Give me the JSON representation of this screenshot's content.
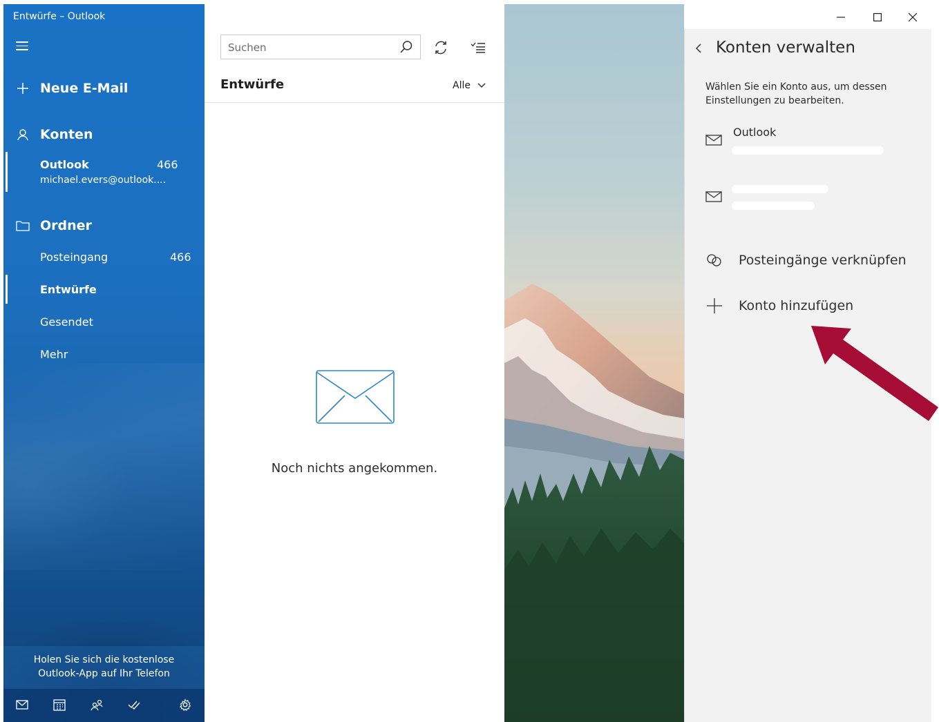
{
  "window": {
    "title": "Entwürfe – Outlook"
  },
  "nav": {
    "new_mail": "Neue E-Mail",
    "accounts_header": "Konten",
    "account": {
      "name": "Outlook",
      "count": "466",
      "email": "michael.evers@outlook...."
    },
    "folders_header": "Ordner",
    "folders": [
      {
        "label": "Posteingang",
        "count": "466"
      },
      {
        "label": "Entwürfe",
        "count": ""
      },
      {
        "label": "Gesendet",
        "count": ""
      },
      {
        "label": "Mehr",
        "count": ""
      }
    ],
    "promo_line1": "Holen Sie sich die kostenlose",
    "promo_line2": "Outlook-App auf Ihr Telefon",
    "bottom_icons": [
      "mail-icon",
      "calendar-icon",
      "people-icon",
      "todo-icon",
      "settings-icon"
    ]
  },
  "list": {
    "search_placeholder": "Suchen",
    "title": "Entwürfe",
    "filter": "Alle",
    "empty_message": "Noch nichts angekommen."
  },
  "flyout": {
    "title": "Konten verwalten",
    "description": "Wählen Sie ein Konto aus, um dessen Einstellungen zu bearbeiten.",
    "accounts": [
      {
        "name": "Outlook"
      },
      {
        "name": ""
      }
    ],
    "link_inboxes": "Posteingänge verknüpfen",
    "add_account": "Konto hinzufügen"
  },
  "colors": {
    "nav_blue": "#1a72c6",
    "flyout_bg": "#f2f2f2",
    "annotation_arrow": "#a50c36"
  }
}
